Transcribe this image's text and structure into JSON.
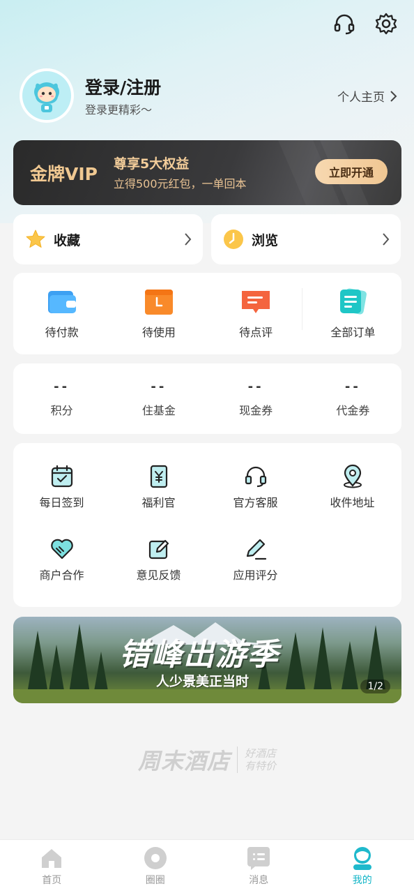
{
  "header": {
    "icons": [
      "headset-icon",
      "gear-icon"
    ]
  },
  "user": {
    "login_title": "登录/注册",
    "login_subtitle": "登录更精彩～",
    "profile_link": "个人主页"
  },
  "vip": {
    "title": "金牌VIP",
    "headline": "尊享5大权益",
    "subline": "立得500元红包，一单回本",
    "button": "立即开通"
  },
  "quick_links": [
    {
      "label": "收藏",
      "icon": "star-icon"
    },
    {
      "label": "浏览",
      "icon": "clock-icon"
    }
  ],
  "orders": [
    {
      "label": "待付款",
      "icon": "wallet-icon"
    },
    {
      "label": "待使用",
      "icon": "ticket-icon"
    },
    {
      "label": "待点评",
      "icon": "comment-icon"
    },
    {
      "label": "全部订单",
      "icon": "orders-icon"
    }
  ],
  "assets": [
    {
      "value": "--",
      "label": "积分"
    },
    {
      "value": "--",
      "label": "住基金"
    },
    {
      "value": "--",
      "label": "现金券"
    },
    {
      "value": "--",
      "label": "代金券"
    }
  ],
  "services": [
    {
      "label": "每日签到",
      "icon": "calendar-check-icon"
    },
    {
      "label": "福利官",
      "icon": "yuan-card-icon"
    },
    {
      "label": "官方客服",
      "icon": "headset-icon"
    },
    {
      "label": "收件地址",
      "icon": "location-pin-icon"
    },
    {
      "label": "商户合作",
      "icon": "handshake-heart-icon"
    },
    {
      "label": "意见反馈",
      "icon": "edit-icon"
    },
    {
      "label": "应用评分",
      "icon": "pen-icon"
    }
  ],
  "banner": {
    "title": "错峰出游季",
    "subtitle": "人少景美正当时",
    "page": "1/2"
  },
  "brand": {
    "name": "周末酒店",
    "slogan_line1": "好酒店",
    "slogan_line2": "有特价"
  },
  "tabbar": [
    {
      "label": "首页",
      "icon": "home-icon",
      "active": false
    },
    {
      "label": "圈圈",
      "icon": "circle-icon",
      "active": false
    },
    {
      "label": "消息",
      "icon": "message-icon",
      "active": false
    },
    {
      "label": "我的",
      "icon": "profile-icon",
      "active": true
    }
  ],
  "colors": {
    "accent": "#12b5c7",
    "vip_gold": "#f0c891"
  }
}
